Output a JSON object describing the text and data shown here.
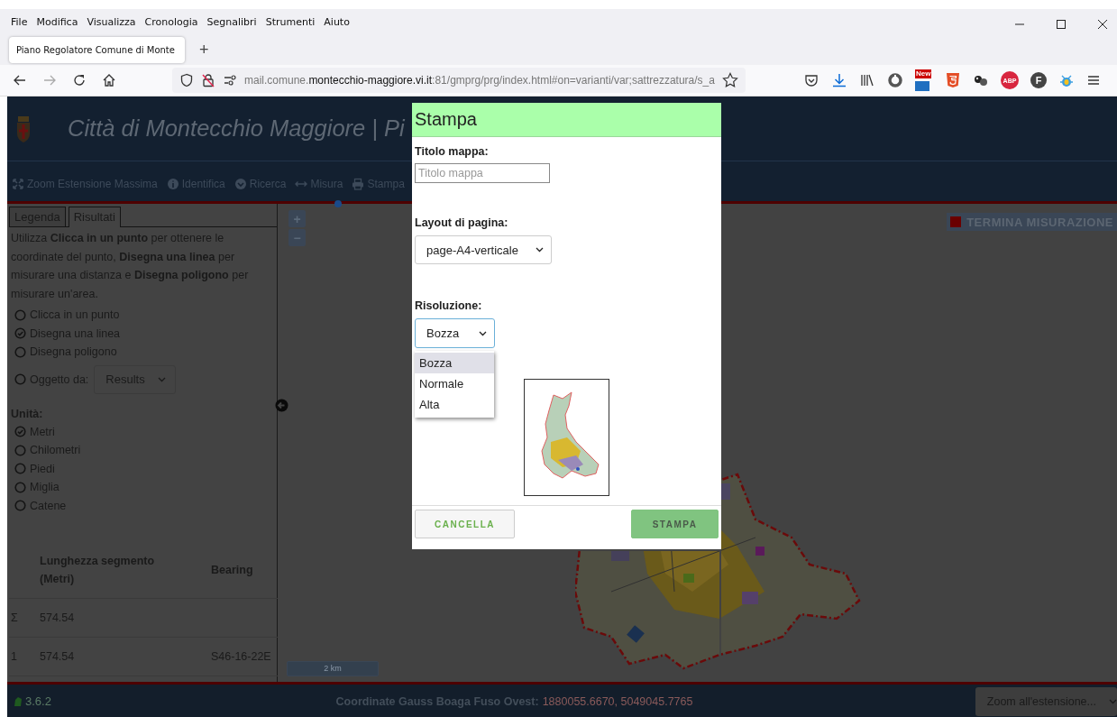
{
  "menu_bar": [
    "File",
    "Modifica",
    "Visualizza",
    "Cronologia",
    "Segnalibri",
    "Strumenti",
    "Aiuto"
  ],
  "browser_tabs": [
    {
      "title": "Piano Regolatore Comune di Monte",
      "selected": true
    }
  ],
  "new_tab": "+",
  "nav": {
    "forward_disabled": true
  },
  "address": {
    "prefix": "mail.comune.",
    "domain": "montecchio-maggiore.vi.it",
    "path": ":81/gmprg/prg/index.html#on=varianti/var;sattrezzatura/s_a"
  },
  "extensions": [
    {
      "kind": "pocket"
    },
    {
      "kind": "download"
    },
    {
      "kind": "library"
    },
    {
      "kind": "ring"
    },
    {
      "kind": "new",
      "badge": "New"
    },
    {
      "kind": "html5"
    },
    {
      "kind": "balls"
    },
    {
      "kind": "abp",
      "badge": "ABP"
    },
    {
      "kind": "letter",
      "badge": "F"
    },
    {
      "kind": "bug"
    },
    {
      "kind": "menu"
    }
  ],
  "header": {
    "title": "Città di Montecchio Maggiore | Pi",
    "tools": [
      {
        "kind": "expand",
        "label": "Zoom Estensione Massima"
      },
      {
        "kind": "info",
        "label": "Identifica"
      },
      {
        "kind": "search",
        "label": "Ricerca"
      },
      {
        "kind": "measure",
        "label": "Misura"
      },
      {
        "kind": "print",
        "label": "Stampa"
      }
    ]
  },
  "panel": {
    "tabs": [
      {
        "label": "Legenda",
        "selected": false
      },
      {
        "label": "Risultati",
        "selected": true
      }
    ],
    "intro": "Utilizza **Clicca in un punto** per ottenere le coordinate del punto, **Disegna una linea** per misurare una distanza e **Disegna poligono** per misurare un'area.",
    "modes": [
      {
        "label": "Clicca in un punto",
        "selected": false
      },
      {
        "label": "Disegna una linea",
        "selected": true
      },
      {
        "label": "Disegna poligono",
        "selected": false
      },
      {
        "label": "Oggetto da:",
        "selected": false,
        "select": "Results"
      }
    ],
    "units_label": "Unità:",
    "units": [
      {
        "label": "Metri",
        "selected": true
      },
      {
        "label": "Chilometri",
        "selected": false
      },
      {
        "label": "Piedi",
        "selected": false
      },
      {
        "label": "Miglia",
        "selected": false
      },
      {
        "label": "Catene",
        "selected": false
      }
    ],
    "table": {
      "columns": [
        "Lunghezza segmento (Metri)",
        "Bearing"
      ],
      "rows": [
        {
          "index": "Σ",
          "length": "574.54"
        },
        {
          "index": "1",
          "length": "574.54",
          "bearing": "S46-16-22E"
        }
      ]
    }
  },
  "map": {
    "zoom_in": "+",
    "zoom_out": "−",
    "scale": "2 km",
    "end_button": "TERMINA MISURAZIONE"
  },
  "footer": {
    "version": "3.6.2",
    "coord_label": "Coordinate Gauss Boaga Fuso Ovest:",
    "coord_value": "1880055.6670, 5049045.7765",
    "zoom_select": "Zoom all'estensione..."
  },
  "dialog": {
    "title": "Stampa",
    "title_label": "Titolo mappa:",
    "title_placeholder": "Titolo mappa",
    "layout_label": "Layout di pagina:",
    "layout_value": "page-A4-verticale",
    "resolution_label": "Risoluzione:",
    "resolution_value": "Bozza",
    "resolution_options": [
      {
        "label": "Bozza",
        "selected": true
      },
      {
        "label": "Normale",
        "selected": false
      },
      {
        "label": "Alta",
        "selected": false
      }
    ],
    "buttons": [
      {
        "label": "CANCELLA",
        "kind": "secondary"
      },
      {
        "label": "STAMPA",
        "kind": "primary"
      }
    ]
  }
}
